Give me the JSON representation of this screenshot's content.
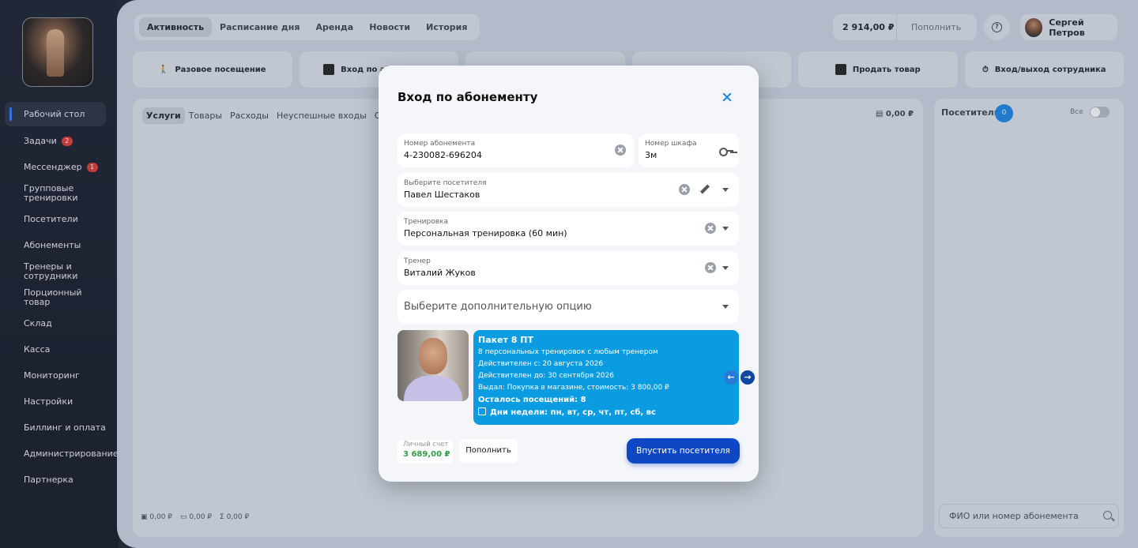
{
  "sidebar": {
    "items": [
      {
        "label": "Рабочий стол",
        "active": true
      },
      {
        "label": "Задачи",
        "badge": "2"
      },
      {
        "label": "Мессенджер",
        "badge": "1"
      },
      {
        "label": "Групповые тренировки"
      },
      {
        "label": "Посетители"
      },
      {
        "label": "Абонементы"
      },
      {
        "label": "Тренеры и сотрудники"
      },
      {
        "label": "Порционный товар"
      },
      {
        "label": "Склад"
      },
      {
        "label": "Касса"
      },
      {
        "label": "Мониторинг"
      },
      {
        "label": "Настройки"
      },
      {
        "label": "Биллинг и оплата"
      },
      {
        "label": "Администрирование"
      },
      {
        "label": "Партнерка"
      }
    ]
  },
  "topnav": {
    "tabs": [
      "Активность",
      "Расписание дня",
      "Аренда",
      "Новости",
      "История"
    ],
    "active": "Активность"
  },
  "header": {
    "balance": "2 914,00 ₽",
    "topup": "Пополнить",
    "user": "Сергей Петров"
  },
  "actions": [
    "Разовое посещение",
    "Вход по абонементу",
    "",
    "",
    "Продать товар",
    "Вход/выход сотрудника"
  ],
  "left_panel": {
    "tabs": [
      "Услуги",
      "Товары",
      "Расходы",
      "Неуспешные входы",
      "Онл"
    ],
    "cash": "0,00 ₽",
    "stats": [
      "0,00 ₽",
      "0,00 ₽",
      "0,00 ₽"
    ]
  },
  "right_panel": {
    "title": "Посетители",
    "count": "0",
    "all": "Все",
    "search_placeholder": "ФИО или номер абонемента"
  },
  "modal": {
    "title": "Вход по абонементу",
    "membership": {
      "label": "Номер абонемента",
      "value": "4-230082-696204"
    },
    "locker": {
      "label": "Номер шкафа",
      "value": "3м"
    },
    "visitor": {
      "label": "Выберите посетителя",
      "value": "Павел Шестаков"
    },
    "training": {
      "label": "Тренировка",
      "value": "Персональная тренировка (60 мин)"
    },
    "trainer": {
      "label": "Тренер",
      "value": "Виталий Жуков"
    },
    "option_placeholder": "Выберите дополнительную опцию",
    "card": {
      "title": "Пакет 8 ПТ",
      "line1": "8 персональных тренировок с любым тренером",
      "line2": "Действителен с: 20 августа 2026",
      "line3": "Действителен до: 30 сентября 2026",
      "line4": "Выдал: Покупка в магазине, стоимость: 3 800,00 ₽",
      "visits": "Осталось посещений: 8",
      "days": "Дни недели: пн, вт, ср, чт, пт, сб, вс"
    },
    "account": {
      "label": "Личный счет",
      "value": "3 689,00 ₽"
    },
    "topup": "Пополнить",
    "admit": "Впустить посетителя"
  },
  "colors": {
    "accent": "#1e88e5",
    "card": "#0a9be0",
    "primary_button": "#0d47c4",
    "money": "#2e9d44"
  }
}
